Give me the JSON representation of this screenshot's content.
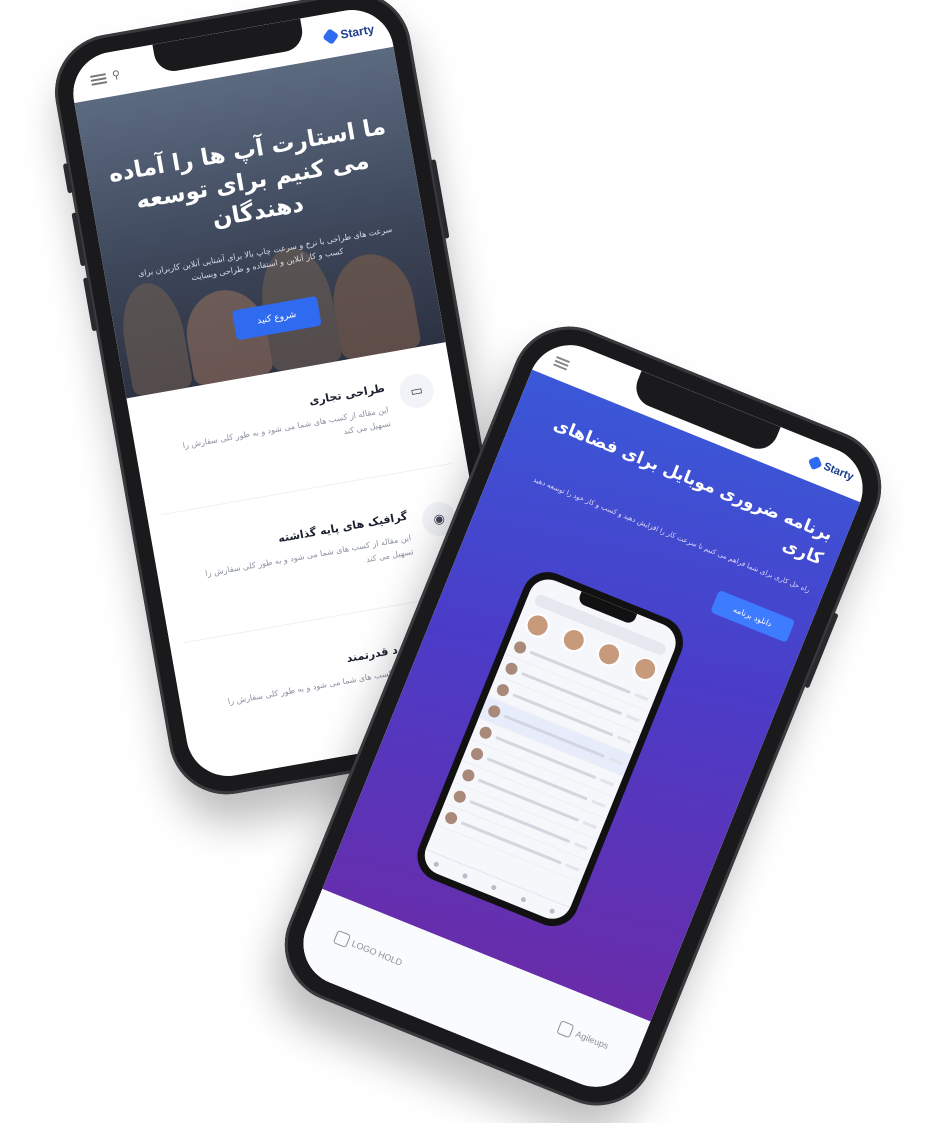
{
  "phone_left": {
    "brand": "Starty",
    "hero": {
      "title": "ما استارت آپ ها را آماده می کنیم برای توسعه دهندگان",
      "description": "سرعت های طراحی با نرخ و سرعت چاپ بالا برای آشنایی آنلاین کاربران برای کسب و کار آنلاین و استفاده و طراحی وبسایت",
      "cta": "شروع کنید"
    },
    "features": [
      {
        "icon": "monitor-icon",
        "title": "طراحی تجاری",
        "text": "این مقاله از کسب های شما می شود و به طور کلی سفارش را تسهیل می کند"
      },
      {
        "icon": "eye-icon",
        "title": "گرافیک های پایه گذاشته",
        "text": "این مقاله از کسب های شما می شود و به طور کلی سفارش را تسهیل می کند"
      },
      {
        "icon": "cloud-icon",
        "title": "عملکرد قدرتمند",
        "text": "این مقاله از کسب های شما می شود و به طور کلی سفارش را تسهیل می کند"
      }
    ]
  },
  "phone_right": {
    "brand": "Starty",
    "hero": {
      "title": "برنامه ضروری موبایل برای فضاهای کاری",
      "description": "راه حل کاری برای شما فراهم می کنیم تا سرعت کار را افزایش دهید و کسب و کار خود را توسعه دهید",
      "cta": "دانلود برنامه"
    },
    "partners": [
      "LOGO HOLD",
      "Agileups"
    ]
  },
  "colors": {
    "accent": "#2e6bf0",
    "hero_gradient_start": "#3a58d8",
    "hero_gradient_end": "#6a2ca8",
    "frame": "#1a1a1c"
  }
}
